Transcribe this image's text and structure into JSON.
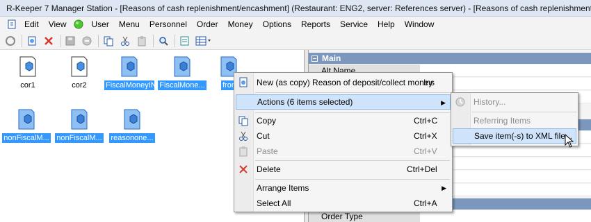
{
  "window": {
    "title": "R-Keeper 7 Manager Station - [Reasons of cash replenishment/encashment] (Restaurant: ENG2, server: References server) - [Reasons of cash replenishment/encashment"
  },
  "menubar": {
    "items": [
      "Edit",
      "View",
      "User",
      "Menu",
      "Personnel",
      "Order",
      "Money",
      "Options",
      "Reports",
      "Service",
      "Help",
      "Window"
    ]
  },
  "items": [
    {
      "label": "cor1",
      "selected": false
    },
    {
      "label": "cor2",
      "selected": false
    },
    {
      "label": "FiscalMoneyIN",
      "selected": true
    },
    {
      "label": "FiscalMone...",
      "selected": true
    },
    {
      "label": "fron",
      "selected": true
    },
    {
      "label": "nonFiscalM...",
      "selected": true
    },
    {
      "label": "nonFiscalM...",
      "selected": true
    },
    {
      "label": "reasonone...",
      "selected": true
    }
  ],
  "properties": {
    "section_main": "Main",
    "alt_name": "Alt Name",
    "order_type": "Order Type"
  },
  "context_menu": {
    "new_copy": {
      "label": "New (as copy) Reason of deposit/collect money",
      "shortcut": "Ins"
    },
    "actions": {
      "label": "Actions (6 items selected)"
    },
    "copy": {
      "label": "Copy",
      "shortcut": "Ctrl+C"
    },
    "cut": {
      "label": "Cut",
      "shortcut": "Ctrl+X"
    },
    "paste": {
      "label": "Paste",
      "shortcut": "Ctrl+V"
    },
    "delete": {
      "label": "Delete",
      "shortcut": "Ctrl+Del"
    },
    "arrange": {
      "label": "Arrange Items"
    },
    "select_all": {
      "label": "Select All",
      "shortcut": "Ctrl+A"
    }
  },
  "submenu": {
    "history": "History...",
    "referring": "Referring Items",
    "save_xml": "Save item(-s) to XML file..."
  },
  "colors": {
    "selection": "#3399ff",
    "section_header": "#7c97be",
    "menu_highlight": "#cfe3fa"
  }
}
